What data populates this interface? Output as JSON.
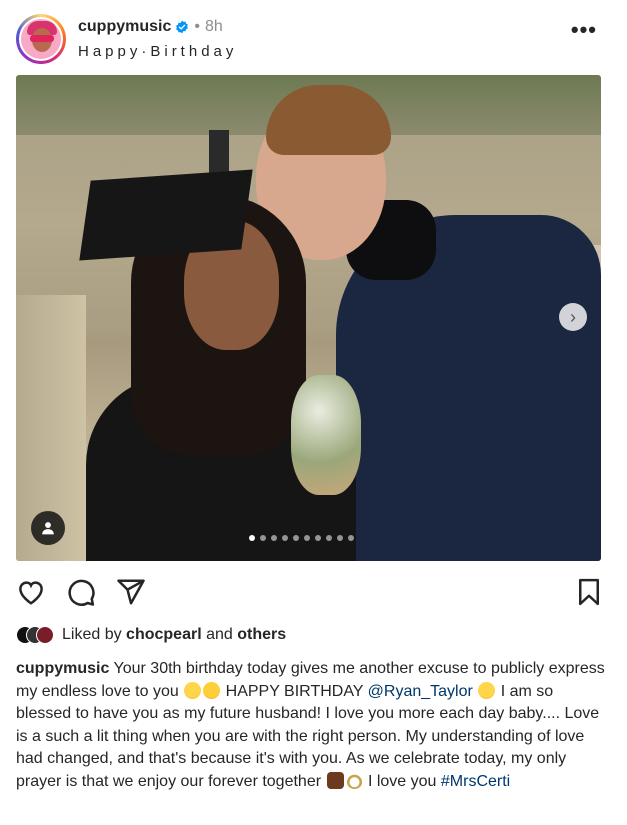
{
  "header": {
    "username": "cuppymusic",
    "separator": "•",
    "time": "8h",
    "audio": "Happy·Birthday",
    "more_label": "•••"
  },
  "media": {
    "next_label": "›",
    "dot_count": 10,
    "active_dot": 0
  },
  "likes": {
    "prefix": "Liked by",
    "user": "chocpearl",
    "conjunction": "and",
    "others": "others"
  },
  "caption": {
    "username": "cuppymusic",
    "part1": "Your 30th birthday today gives me another excuse to publicly express my endless love to you",
    "part2": "HAPPY BIRTHDAY",
    "mention": "@Ryan_Taylor",
    "part3": "I am so blessed to have you as my future husband! I love you more each day baby.... Love is a such a lit thing when you are with the right person. My understanding of love had changed, and that's because it's with you. As we celebrate today, my only prayer is that we enjoy our forever together",
    "part4": "I love you",
    "hashtag": "#MrsCerti"
  },
  "colors": {
    "link": "#00376b",
    "verified": "#0095f6",
    "text": "#262626",
    "muted": "#8e8e8e"
  }
}
